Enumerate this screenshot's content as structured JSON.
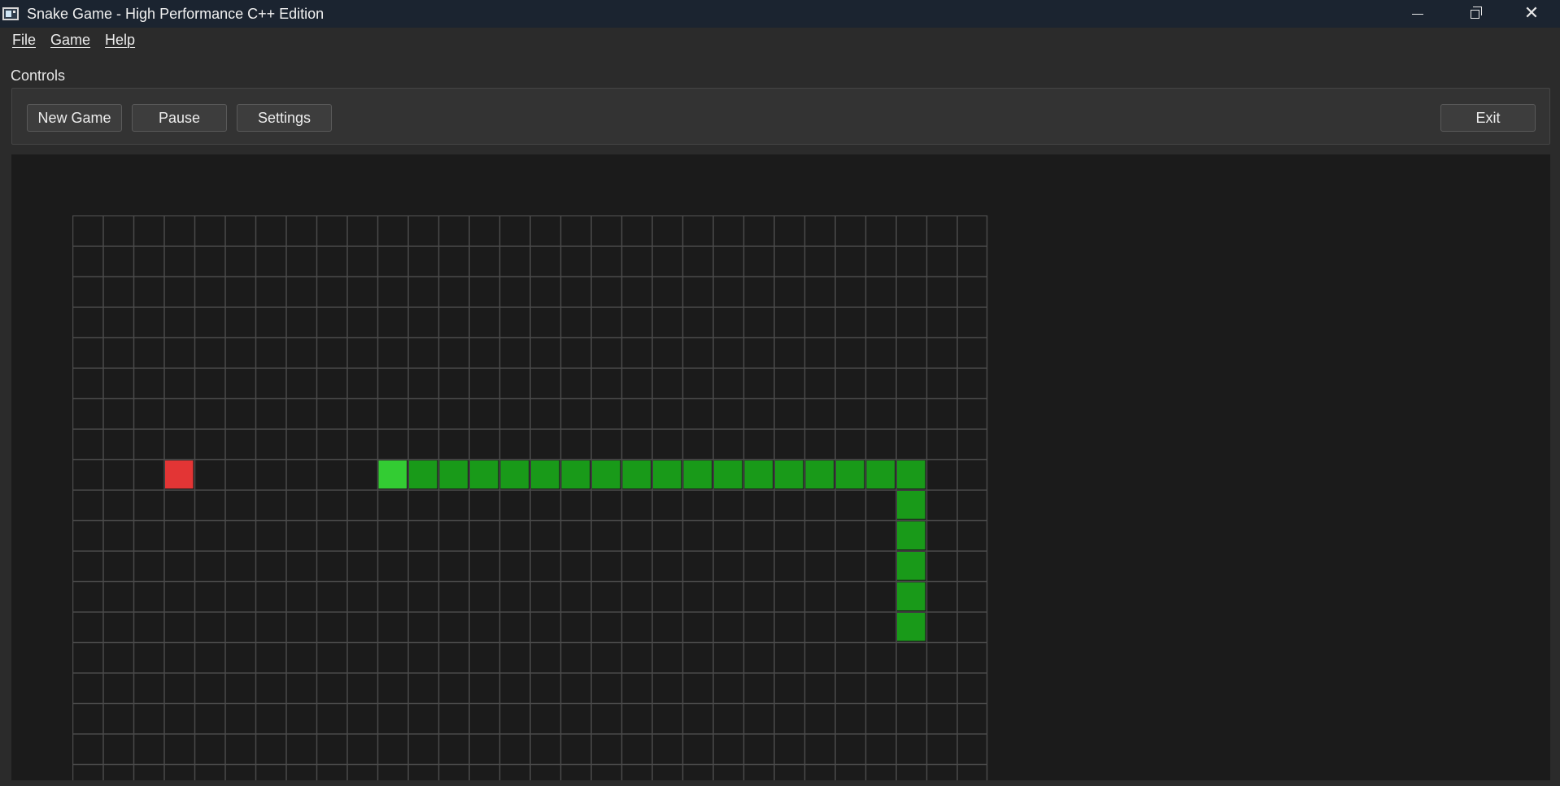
{
  "window": {
    "title": "Snake Game - High Performance C++ Edition",
    "icon": "app-window-icon"
  },
  "menu": [
    "File",
    "Game",
    "Help"
  ],
  "controls": {
    "group_label": "Controls",
    "new_game": "New Game",
    "pause": "Pause",
    "settings": "Settings",
    "exit": "Exit"
  },
  "board": {
    "visible_columns": 30,
    "visible_rows": 19,
    "snake": {
      "head": [
        10,
        8
      ],
      "body": [
        [
          11,
          8
        ],
        [
          12,
          8
        ],
        [
          13,
          8
        ],
        [
          14,
          8
        ],
        [
          15,
          8
        ],
        [
          16,
          8
        ],
        [
          17,
          8
        ],
        [
          18,
          8
        ],
        [
          19,
          8
        ],
        [
          20,
          8
        ],
        [
          21,
          8
        ],
        [
          22,
          8
        ],
        [
          23,
          8
        ],
        [
          24,
          8
        ],
        [
          25,
          8
        ],
        [
          26,
          8
        ],
        [
          27,
          8
        ],
        [
          27,
          9
        ],
        [
          27,
          10
        ],
        [
          27,
          11
        ],
        [
          27,
          12
        ],
        [
          27,
          13
        ]
      ]
    },
    "food": [
      3,
      8
    ]
  },
  "colors": {
    "grid_line": "#4a4a4a",
    "board_bg": "#1b1b1b",
    "snake_head": "#33cc33",
    "snake_body": "#199a19",
    "food": "#e33535"
  }
}
